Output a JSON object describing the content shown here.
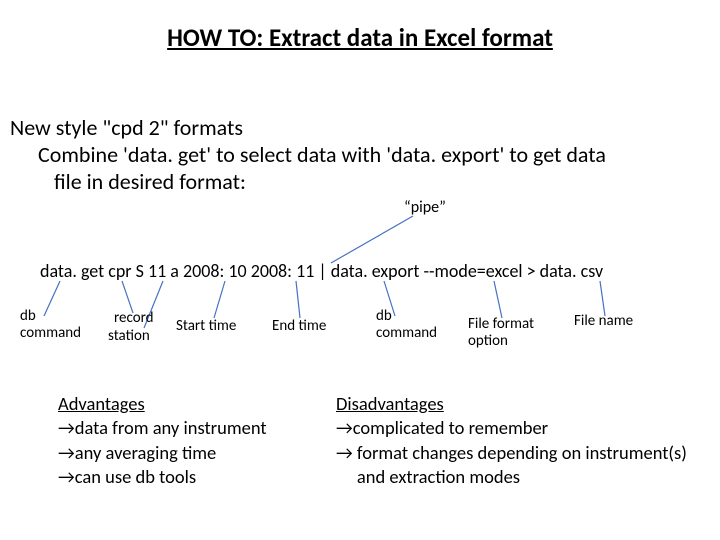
{
  "title": "HOW TO: Extract data in Excel format",
  "intro": {
    "line1": "New style \"cpd 2\" formats",
    "line2": "Combine 'data. get' to select data with 'data. export' to get data",
    "line3": "file in desired format:"
  },
  "pipe_label": "“pipe”",
  "command": "data. get  cpr  S 11 a  2008: 10  2008: 11 |  data. export  --mode=excel > data. csv",
  "annotations": {
    "db_command_1": "db\ncommand",
    "record": "record",
    "station": "station",
    "start_time": "Start time",
    "end_time": "End time",
    "db_command_2": "db\ncommand",
    "file_format_option": "File format\noption",
    "file_name": "File name"
  },
  "advantages": {
    "header": "Advantages",
    "items": [
      "data from any instrument",
      "any averaging time",
      "can use db tools"
    ]
  },
  "disadvantages": {
    "header": "Disadvantages",
    "items": [
      "complicated to remember",
      " format changes depending on instrument(s)",
      "  and extraction modes"
    ]
  },
  "arrow": "→"
}
